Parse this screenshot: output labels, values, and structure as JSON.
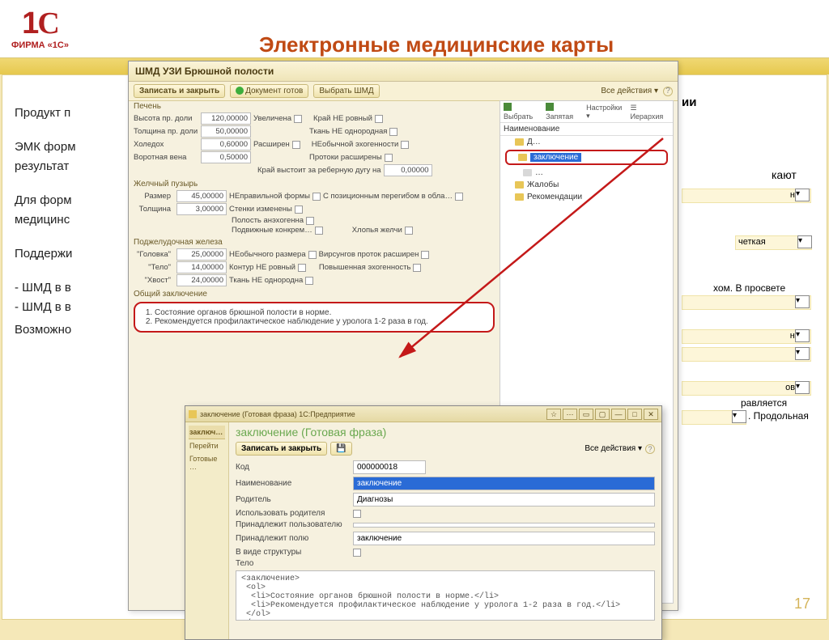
{
  "page": {
    "logo_brand": "ФИРМА «1С»",
    "title": "Электронные медицинские карты",
    "pagenum": "17"
  },
  "lefttext": {
    "p1": "Продукт п",
    "p2a": "ЭМК форм",
    "p2b": "результат",
    "p3a": "Для форм",
    "p3b": "медицинс",
    "p4": "Поддержи",
    "p5a": "- ШМД в в",
    "p5b": "- ШМД в в",
    "p6": "Возможно"
  },
  "righttext": {
    "t1": "ии",
    "t2": "кают",
    "t3": "ная",
    "t4": "четкая",
    "t5": "хом. В просвете",
    "t6": "нно",
    "t7": "овая",
    "t8": "равляется",
    "t9": ". Продольная"
  },
  "win1": {
    "title": "ШМД УЗИ Брюшной полости",
    "tb": {
      "save_close": "Записать и закрыть",
      "doc_ready": "Документ готов",
      "choose_shmd": "Выбрать ШМД",
      "all_actions": "Все действия ▾"
    },
    "rp": {
      "select": "Выбрать",
      "comma": "Запятая",
      "settings": "Настройки ▾",
      "hierarchy": "Иерархия",
      "hdr": "Наименование",
      "items": [
        "заключение",
        "Жалобы",
        "Рекомендации"
      ]
    },
    "liver_title": "Печень",
    "liver": {
      "h_lab": "Высота пр. доли",
      "h": "120,00000",
      "t_lab": "Толщина пр. доли",
      "t": "50,00000",
      "x_lab": "Холедох",
      "x": "0,60000",
      "v_lab": "Воротная вена",
      "v": "0,50000",
      "c1": "Увеличена",
      "c2": "Край НЕ ровный",
      "c3": "Ткань НЕ однородная",
      "c4": "Расширен",
      "c5": "НЕобычной эхогенности",
      "c6": "Протоки расширены",
      "c7": "Край выстоит за реберную дугу на",
      "cv": "0,00000"
    },
    "gall_title": "Желчный пузырь",
    "gall": {
      "r_lab": "Размер",
      "r": "45,00000",
      "c1": "НЕправильной формы",
      "c2": "С позиционным перегибом в обла…",
      "t_lab": "Толщина",
      "t": "3,00000",
      "c3": "Стенки изменены",
      "c4": "Полость анэхогенна",
      "c5": "Подвижные конкрем…",
      "c6": "Хлопья желчи"
    },
    "panc_title": "Поджелудочная железа",
    "panc": {
      "g_lab": "\"Головка\"",
      "g": "25,00000",
      "c1": "НЕобычного размера",
      "c2": "Вирсунгов проток расширен",
      "b_lab": "\"Тело\"",
      "b": "14,00000",
      "c3": "Контур НЕ ровный",
      "c4": "Повышенная эхогенность",
      "x_lab": "\"Хвост\"",
      "x": "24,00000",
      "c5": "Ткань НЕ однородна"
    },
    "zak_title": "Общий заключение",
    "zak": {
      "l1": "Состояние органов брюшной полости в норме.",
      "l2": "Рекомендуется профилактическое наблюдение у уролога 1-2 раза в год."
    }
  },
  "win2": {
    "chrome": "заключение (Готовая фраза) 1С:Предприятие",
    "side": {
      "s1": "заключ…",
      "s2": "Перейти",
      "s3": "Готовые …"
    },
    "title": "заключение (Готовая фраза)",
    "save_close": "Записать и закрыть",
    "all_actions": "Все действия ▾",
    "fields": {
      "code_lab": "Код",
      "code": "000000018",
      "name_lab": "Наименование",
      "name": "заключение",
      "parent_lab": "Родитель",
      "parent": "Диагнозы",
      "useparent_lab": "Использовать родителя",
      "owner_lab": "Принадлежит пользователю",
      "field_lab": "Принадлежит полю",
      "field": "заключение",
      "struct_lab": "В виде структуры",
      "body_lab": "Тело"
    },
    "code": "<заключение>\n <ol>\n  <li>Состояние органов брюшной полости в норме.</li>\n  <li>Рекомендуется профилактическое наблюдение у уролога 1-2 раза в год.</li>\n </ol>\n</заключение>"
  }
}
